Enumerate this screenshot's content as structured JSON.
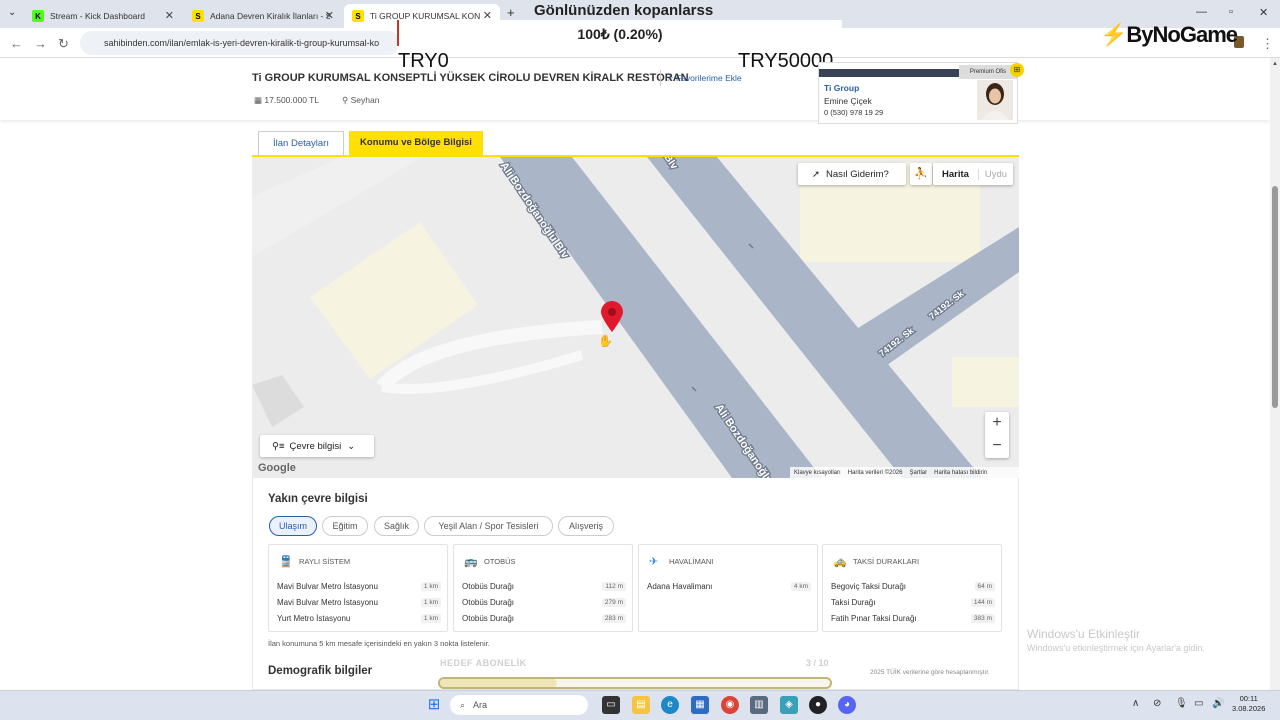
{
  "browser": {
    "tabs": [
      {
        "title": "Stream - Kick Dashboard",
        "favicon": "K"
      },
      {
        "title": "Adana Devren Kiralık İlanları - S",
        "favicon": "S"
      },
      {
        "title": "Ti GROUP KURUMSAL KONSEPTLİ",
        "favicon": "S"
      }
    ],
    "url": "sahibinden.com/ilan/emlak-is-yeri-devren-kiralik-ti-group-kurumsal-ko"
  },
  "overlay": {
    "title": "Gönlünüzden kopanlarss",
    "percent": "100₺ (0.20%)",
    "min": "TRY0",
    "max": "TRY50000",
    "brand": "ByNoGame",
    "goal_label": "HEDEF ABONELİK",
    "goal_count": "3 / 10",
    "goal_progress": 0.3
  },
  "listing": {
    "title": "Ti GROUP KURUMSAL KONSEPTLİ YÜKSEK CİROLU DEVREN KİRALK RESTORAN",
    "favorite": "Favorilerime Ekle",
    "price": "17.500.000 TL",
    "location": "Seyhan"
  },
  "agent": {
    "badge": "Premium Ofis",
    "company": "Ti Group",
    "name": "Emine Çiçek",
    "phone": "0 (530) 978 19 29"
  },
  "tabs": {
    "details": "İlan Detayları",
    "location": "Konumu ve Bölge Bilgisi"
  },
  "map": {
    "how_to_go": "Nasıl Giderim?",
    "map_btn": "Harita",
    "sat_btn": "Uydu",
    "env_info": "Çevre bilgisi",
    "google": "Google",
    "road1": "Ali Bozdoğanoğlu Blv",
    "road2": "Ali Bozdoğanoğlu",
    "road_frag": "Blv",
    "street1": "74192. Sk",
    "street2": "74192. Sk",
    "attribution": [
      "Klavye kısayolları",
      "Harita verileri ©2026",
      "Şartlar",
      "Harita hatası bildirin"
    ]
  },
  "nearby": {
    "title": "Yakın çevre bilgisi",
    "chips": [
      "Ulaşım",
      "Eğitim",
      "Sağlık",
      "Yeşil Alan / Spor Tesisleri",
      "Alışveriş"
    ],
    "cards": [
      {
        "header": "RAYLI SİSTEM",
        "icon": "train-icon",
        "rows": [
          {
            "name": "Mavi Bulvar Metro İstasyonu",
            "dist": "1 km"
          },
          {
            "name": "Mavi Bulvar Metro İstasyonu",
            "dist": "1 km"
          },
          {
            "name": "Yurt Metro İstasyonu",
            "dist": "1 km"
          }
        ]
      },
      {
        "header": "OTOBÜS",
        "icon": "bus-icon",
        "rows": [
          {
            "name": "Otobüs Durağı",
            "dist": "112 m"
          },
          {
            "name": "Otobüs Durağı",
            "dist": "279 m"
          },
          {
            "name": "Otobüs Durağı",
            "dist": "283 m"
          }
        ]
      },
      {
        "header": "HAVALİMANI",
        "icon": "plane-icon",
        "rows": [
          {
            "name": "Adana Havalimanı",
            "dist": "4 km"
          }
        ]
      },
      {
        "header": "TAKSİ DURAKLARI",
        "icon": "taxi-icon",
        "rows": [
          {
            "name": "Begoviç Taksi Durağı",
            "dist": "64 m"
          },
          {
            "name": "Taksi Durağı",
            "dist": "144 m"
          },
          {
            "name": "Fatih Pınar Taksi Durağı",
            "dist": "383 m"
          }
        ]
      }
    ],
    "note": "İlan konumuna 5 km mesafe içerisindeki en yakın 3 nokta listelenir.",
    "demographic": "Demografik bilgiler",
    "tuik": "2025 TÜİK verilerine göre hesaplanmıştır."
  },
  "windows": {
    "activate_title": "Windows'u Etkinleştir",
    "activate_sub": "Windows'u etkinleştirmek için Ayarlar'a gidin.",
    "search": "Ara",
    "time": "00:11",
    "date": "3.08.2026"
  },
  "colors": {
    "accent_yellow": "#ffe000",
    "link_blue": "#2a5ea8",
    "pin_red": "#e1192d",
    "road": "#aab6c7"
  }
}
